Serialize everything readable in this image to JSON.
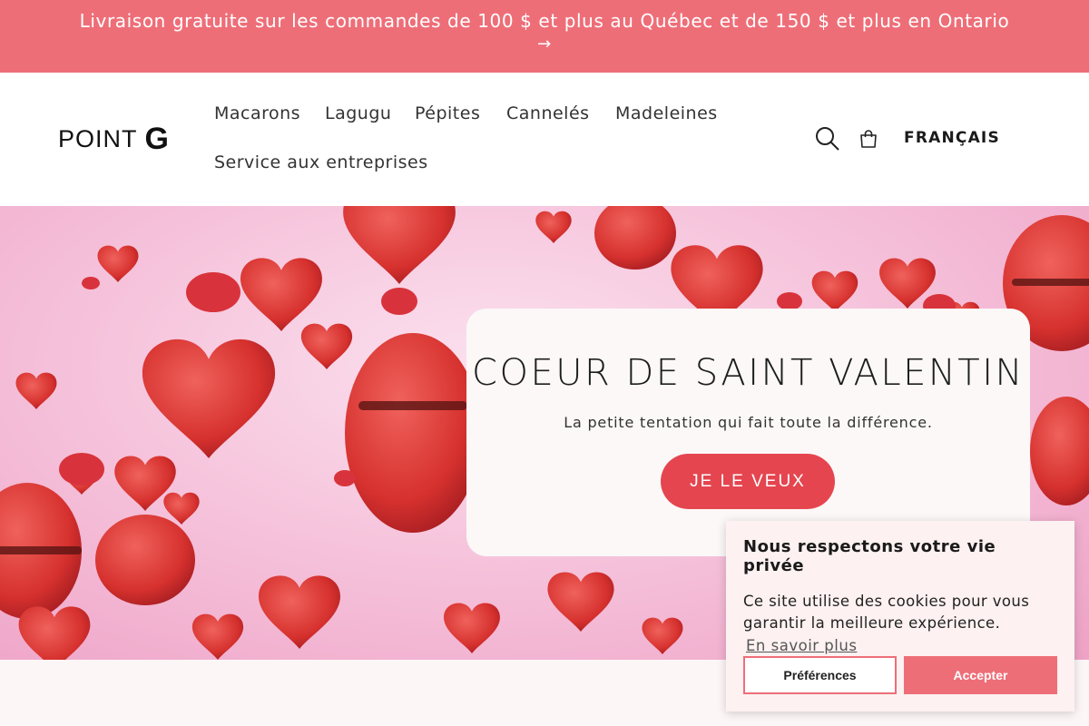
{
  "announcement": {
    "text": "Livraison gratuite sur les commandes de 100 $ et plus au Québec et de 150 $ et plus en Ontario",
    "arrow": "→"
  },
  "header": {
    "logo_word": "POINT",
    "logo_letter": "G",
    "nav": [
      "Macarons",
      "Lagugu",
      "Pépites",
      "Cannelés",
      "Madeleines",
      "Service aux entreprises"
    ],
    "language": "FRANÇAIS",
    "icons": [
      "search-icon",
      "cart-icon"
    ]
  },
  "hero": {
    "title": "COEUR DE SAINT VALENTIN",
    "subtitle": "La petite tentation qui fait toute la différence.",
    "button": "JE LE VEUX"
  },
  "cookie_banner": {
    "title": "Nous respectons votre vie privée",
    "text": "Ce site utilise des cookies pour vous garantir la meilleure expérience.",
    "link": "En savoir plus",
    "preferences": "Préférences",
    "accept": "Accepter"
  },
  "colors": {
    "announcement_bg": "#ee6e78",
    "hero_button": "#e5454f",
    "hero_bg": "#f6c4dc",
    "macaron_red": "#d8333c"
  }
}
